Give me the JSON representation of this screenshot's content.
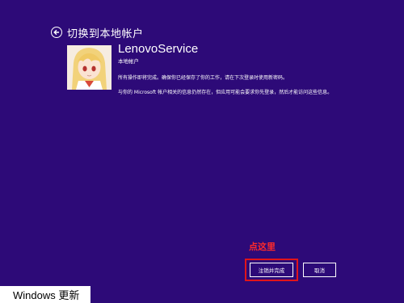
{
  "header": {
    "title": "切换到本地帐户",
    "back_icon": "back-arrow-icon"
  },
  "account": {
    "name": "LenovoService",
    "type": "本地帐户",
    "avatar": "anime-avatar"
  },
  "message": {
    "p1": "所有操作即将完成。确保你已经保存了你的工作，请在下次登录时使用新密码。",
    "p2": "与你的 Microsoft 帐户相关的信息仍然存在，但应用可能会要求你先登录，然后才能访问这些信息。"
  },
  "annotation": {
    "hint": "点这里",
    "highlight_color": "#e1141a"
  },
  "buttons": {
    "signout_label": "注销并完成",
    "cancel_label": "取消"
  },
  "footer": {
    "caption": "Windows 更新"
  },
  "colors": {
    "background": "#2d0a78",
    "text": "#ffffff"
  }
}
